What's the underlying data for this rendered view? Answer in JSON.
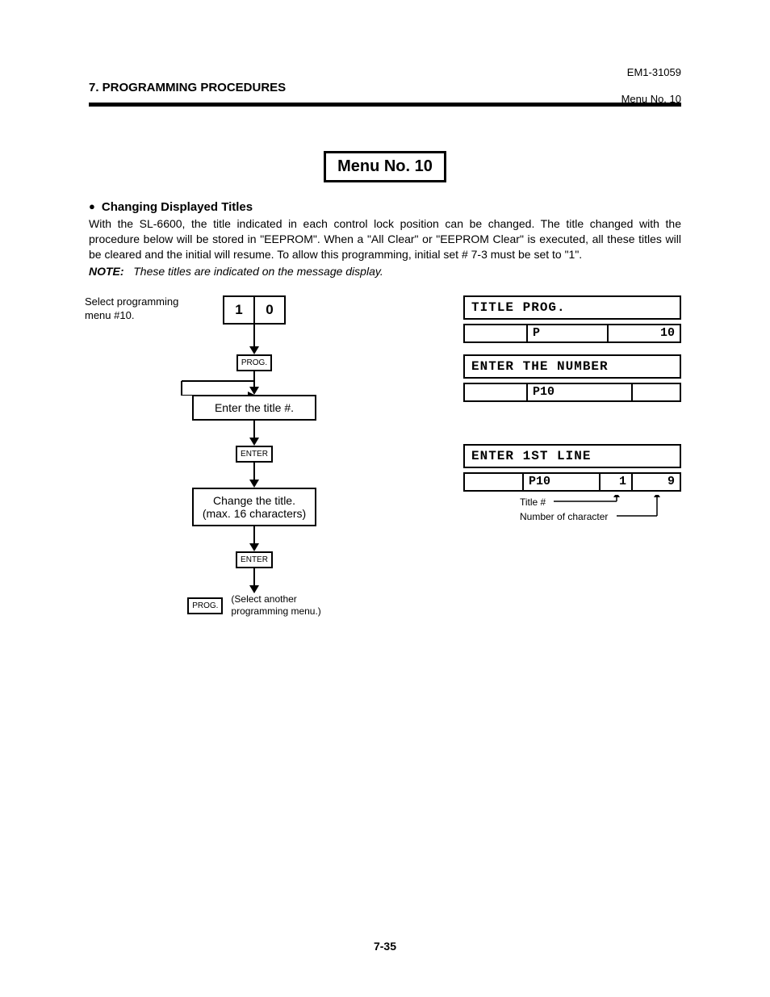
{
  "header": {
    "section": "7. PROGRAMMING PROCEDURES",
    "docno": "EM1-31059",
    "menuno": "Menu No. 10"
  },
  "title": "Menu No. 10",
  "bullet_heading": "Changing Displayed Titles",
  "paragraph": "With the SL-6600, the title indicated in each control lock position can be changed. The title changed with the procedure below will be stored in \"EEPROM\". When a \"All Clear\" or \"EEPROM Clear\" is executed, all these titles will be cleared and the initial will resume. To allow this programming, initial set # 7-3 must be set to \"1\".",
  "note_label": "NOTE:",
  "note_text": "These titles are indicated on the message display.",
  "flow": {
    "select_label": "Select programming menu #10.",
    "key1": "1",
    "key2": "0",
    "prog": "PROG.",
    "step_enter_title": "Enter the title #.",
    "enter": "ENTER",
    "step_change_title_l1": "Change the title.",
    "step_change_title_l2": "(max. 16 characters)",
    "select_note_l1": "(Select another",
    "select_note_l2": "programming menu.)"
  },
  "displays": {
    "d1_header": "TITLE PROG.",
    "d1_c1": "",
    "d1_c2": "P",
    "d1_c3": "10",
    "d2_header": "ENTER THE NUMBER",
    "d2_c1": "",
    "d2_c2": "P10",
    "d2_c3": "",
    "d3_header": "ENTER 1ST LINE",
    "d3_c1": "",
    "d3_c2": "P10",
    "d3_c3": "1",
    "d3_c4": "9",
    "annot1": "Title #",
    "annot2": "Number of character"
  },
  "pagenum": "7-35"
}
